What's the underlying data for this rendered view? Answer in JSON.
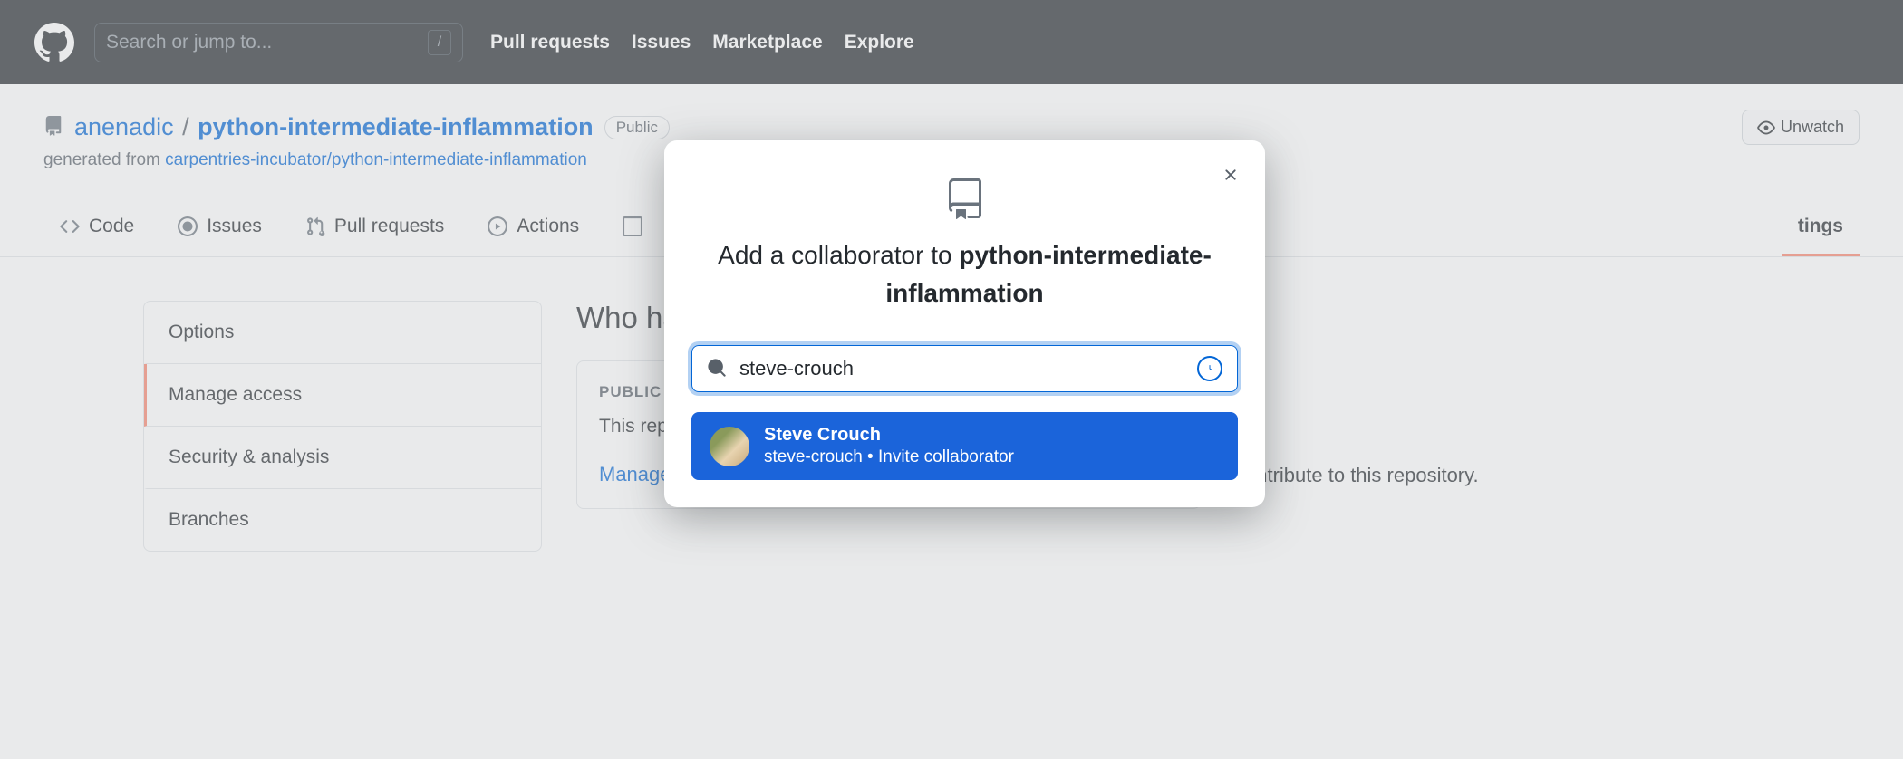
{
  "header": {
    "search_placeholder": "Search or jump to...",
    "kbd": "/",
    "nav": [
      "Pull requests",
      "Issues",
      "Marketplace",
      "Explore"
    ]
  },
  "repo": {
    "owner": "anenadic",
    "name": "python-intermediate-inflammation",
    "visibility": "Public",
    "generated_prefix": "generated from ",
    "generated_link": "carpentries-incubator/python-intermediate-inflammation",
    "unwatch_label": "Unwatch"
  },
  "tabs": {
    "code": "Code",
    "issues": "Issues",
    "pulls": "Pull requests",
    "actions": "Actions",
    "settings": "tings"
  },
  "sidebar": {
    "options": "Options",
    "manage_access": "Manage access",
    "security": "Security & analysis",
    "branches": "Branches"
  },
  "content": {
    "heading": "Who has access",
    "badge": "PUBLIC REPOSITORY",
    "body": "This repository is public and visible to anyone.",
    "body2": "contribute to this repository.",
    "manage": "Manage"
  },
  "dialog": {
    "title_prefix": "Add a collaborator to ",
    "title_repo": "python-intermediate-inflammation",
    "search_value": "steve-crouch",
    "result_name": "Steve Crouch",
    "result_sub": "steve-crouch • Invite collaborator"
  }
}
